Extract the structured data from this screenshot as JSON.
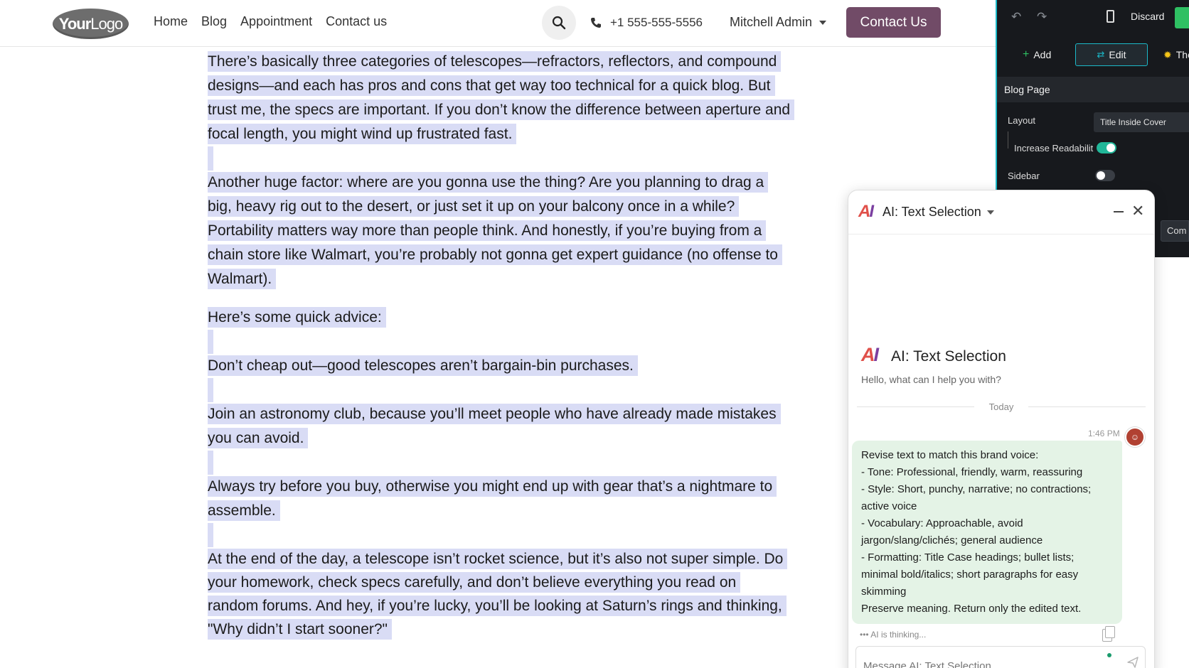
{
  "header": {
    "logo_bold": "Your",
    "logo_rest": "Logo",
    "nav": [
      "Home",
      "Blog",
      "Appointment",
      "Contact us"
    ],
    "phone": "+1 555-555-5556",
    "user": "Mitchell Admin",
    "cta": "Contact Us"
  },
  "article": {
    "p1": "There’s basically three categories of telescopes—refractors, reflectors, and compound designs—and each has pros and cons that get way too technical for a quick blog. But trust me, the specs are important. If you don’t know the difference between aperture and focal length, you might wind up frustrated fast.",
    "p2": "Another huge factor: where are you gonna use the thing? Are you planning to drag a big, heavy rig out to the desert, or just set it up on your balcony once in a while? Portability matters way more than people think. And honestly, if you’re buying from a chain store like Walmart, you’re probably not gonna get expert guidance (no offense to Walmart).",
    "p3": "Here’s some quick advice:",
    "p4": "Don’t cheap out—good telescopes aren’t bargain-bin purchases.",
    "p5": "Join an astronomy club, because you’ll meet people who have already made mistakes you can avoid.",
    "p6": "Always try before you buy, otherwise you might end up with gear that’s a nightmare to assemble.",
    "p7": "At the end of the day, a telescope isn’t rocket science, but it’s also not super simple. Do your homework, check specs carefully, and don’t believe everything you read on random forums. And hey, if you’re lucky, you’ll be looking at Saturn’s rings and thinking, \"Why didn’t I start sooner?\""
  },
  "editor": {
    "discard": "Discard",
    "tabs": {
      "add": "Add",
      "edit": "Edit",
      "theme": "The"
    },
    "section": "Blog Page",
    "layout_label": "Layout",
    "layout_value": "Title Inside Cover",
    "readability_label": "Increase Readabilit",
    "sidebar_label": "Sidebar",
    "chip": "Com"
  },
  "ai": {
    "title": "AI: Text Selection",
    "intro_title": "AI: Text Selection",
    "intro_sub": "Hello, what can I help you with?",
    "day": "Today",
    "time": "1:46 PM",
    "message_lines": [
      "Revise text to match this brand voice:",
      "- Tone: Professional, friendly, warm, reassuring",
      "- Style: Short, punchy, narrative; no contractions; active voice",
      "- Vocabulary: Approachable, avoid jargon/slang/clichés; general audience",
      "- Formatting: Title Case headings; bullet lists; minimal bold/italics; short paragraphs for easy skimming",
      "Preserve meaning. Return only the edited text."
    ],
    "thinking": "••• AI is thinking...",
    "input_placeholder": "Message AI: Text Selection..."
  }
}
